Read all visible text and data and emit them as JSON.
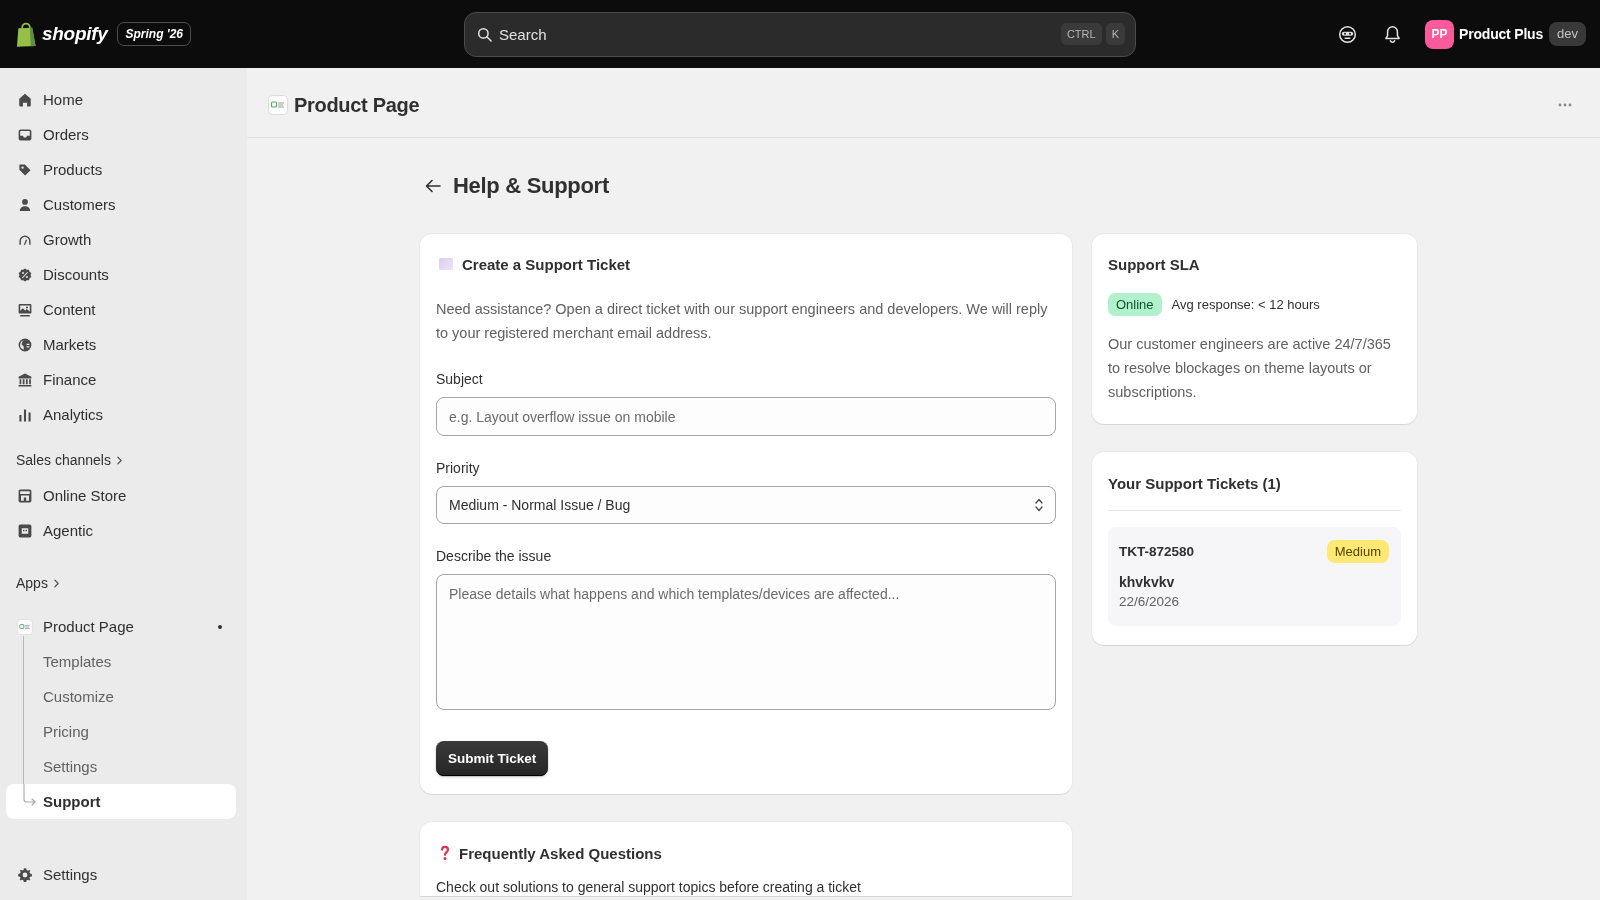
{
  "topbar": {
    "brand": "shopify",
    "edition_badge": "Spring '26",
    "search": {
      "placeholder": "Search",
      "shortcut_keys": [
        "CTRL",
        "K"
      ]
    },
    "account": {
      "initials": "PP",
      "store_name": "Product Plus",
      "environment_badge": "dev"
    }
  },
  "sidebar": {
    "nav": [
      {
        "label": "Home",
        "selected": false
      },
      {
        "label": "Orders",
        "selected": false
      },
      {
        "label": "Products",
        "selected": false
      },
      {
        "label": "Customers",
        "selected": false
      },
      {
        "label": "Growth",
        "selected": false
      },
      {
        "label": "Discounts",
        "selected": false
      },
      {
        "label": "Content",
        "selected": false
      },
      {
        "label": "Markets",
        "selected": false
      },
      {
        "label": "Finance",
        "selected": false
      },
      {
        "label": "Analytics",
        "selected": false
      }
    ],
    "sales_channels": {
      "heading": "Sales channels",
      "items": [
        {
          "label": "Online Store",
          "selected": false
        },
        {
          "label": "Agentic",
          "selected": false
        }
      ]
    },
    "apps": {
      "heading": "Apps",
      "items": [
        {
          "label": "Product Page",
          "selected": false,
          "children": [
            {
              "label": "Templates",
              "selected": false
            },
            {
              "label": "Customize",
              "selected": false
            },
            {
              "label": "Pricing",
              "selected": false
            },
            {
              "label": "Settings",
              "selected": false
            },
            {
              "label": "Support",
              "selected": true
            }
          ]
        }
      ]
    },
    "footer_item": {
      "label": "Settings",
      "selected": false
    }
  },
  "page_header": {
    "title": "Product Page"
  },
  "page_title": "Help & Support",
  "ticket_form": {
    "title": "Create a Support Ticket",
    "description": "Need assistance? Open a direct ticket with our support engineers and developers. We will reply to your registered merchant email address.",
    "fields": [
      {
        "kind": "text",
        "label": "Subject",
        "placeholder": "e.g. Layout overflow issue on mobile"
      },
      {
        "kind": "select",
        "label": "Priority",
        "value": "Medium - Normal Issue / Bug"
      },
      {
        "kind": "textarea",
        "label": "Describe the issue",
        "placeholder": "Please details what happens and which templates/devices are affected..."
      }
    ],
    "submit_button": "Submit Ticket"
  },
  "faq_card": {
    "title": "Frequently Asked Questions",
    "description": "Check out solutions to general support topics before creating a ticket"
  },
  "sla_card": {
    "title": "Support SLA",
    "status": {
      "label": "Online",
      "online": true
    },
    "avg_response": "Avg response: < 12 hours",
    "description": "Our customer engineers are active 24/7/365 to resolve blockages on theme layouts or subscriptions."
  },
  "tickets_card": {
    "title": "Your Support Tickets (1)",
    "tickets": [
      {
        "id": "TKT-872580",
        "priority": "Medium",
        "color": "#ffe873",
        "subject": "khvkvkv",
        "date": "22/6/2026"
      }
    ]
  }
}
